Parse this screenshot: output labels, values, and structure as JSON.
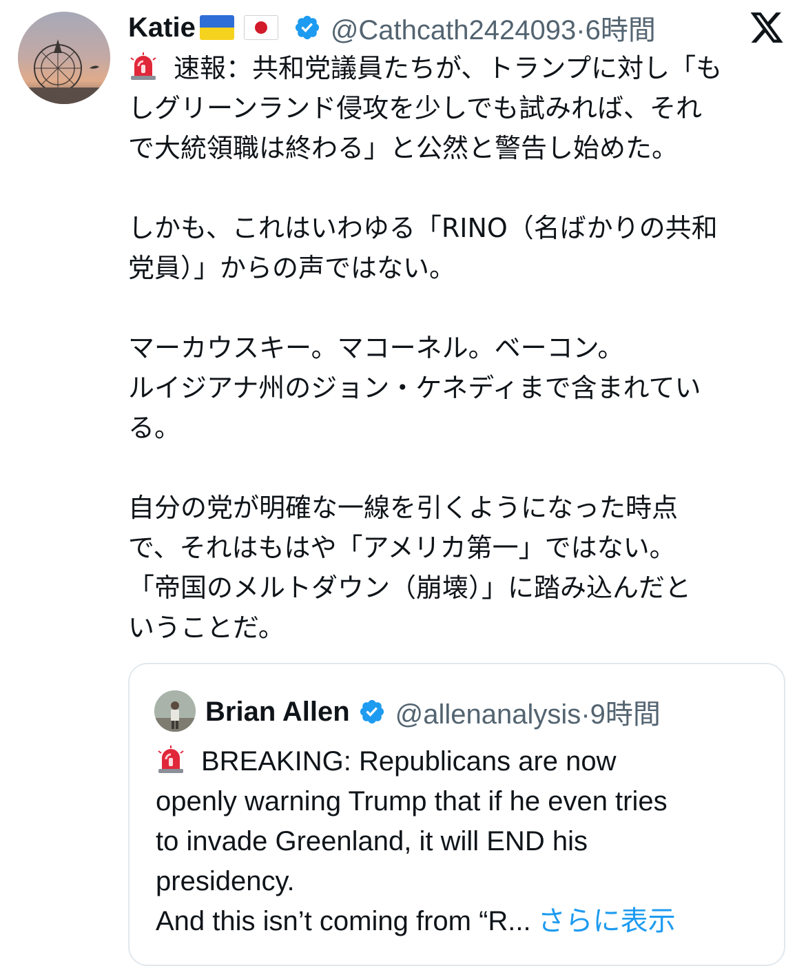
{
  "post": {
    "author_name": "Katie",
    "author_handle": "@Cathcath2424093",
    "time_sep": "·",
    "time": "6時間",
    "flags": [
      "ukraine-flag",
      "japan-flag"
    ],
    "body_lines": [
      {
        "text": "速報：共和党議員たちが、トランプに対し「も",
        "siren": true
      },
      {
        "text": "しグリーンランド侵攻を少しでも試みれば、それ"
      },
      {
        "text": "で大統領職は終わる」と公然と警告し始めた。"
      },
      {
        "gap": true
      },
      {
        "text": "しかも、これはいわゆる「RINO（名ばかりの共和"
      },
      {
        "text": "党員）」からの声ではない。"
      },
      {
        "gap": true
      },
      {
        "text": "マーカウスキー。マコーネル。ベーコン。"
      },
      {
        "text": "ルイジアナ州のジョン・ケネディまで含まれてい"
      },
      {
        "text": "る。"
      },
      {
        "gap": true
      },
      {
        "text": "自分の党が明確な一線を引くようになった時点"
      },
      {
        "text": "で、それはもはや「アメリカ第一」ではない。"
      },
      {
        "text": "「帝国のメルトダウン（崩壊）」に踏み込んだと"
      },
      {
        "text": "いうことだ。"
      }
    ]
  },
  "quote": {
    "author_name": "Brian Allen",
    "author_handle": "@allenanalysis",
    "time_sep": "·",
    "time": "9時間",
    "lines": [
      "BREAKING: Republicans are now",
      "openly warning Trump that if he even tries",
      "to invade Greenland, it will END his",
      "presidency.",
      "And this isn’t coming from “R..."
    ],
    "show_more_label": "さらに表示"
  },
  "colors": {
    "text": "#0f1419",
    "secondary": "#536471",
    "link": "#1d9bf0",
    "verified": "#1d9bf0",
    "border": "#e1e8ed"
  }
}
